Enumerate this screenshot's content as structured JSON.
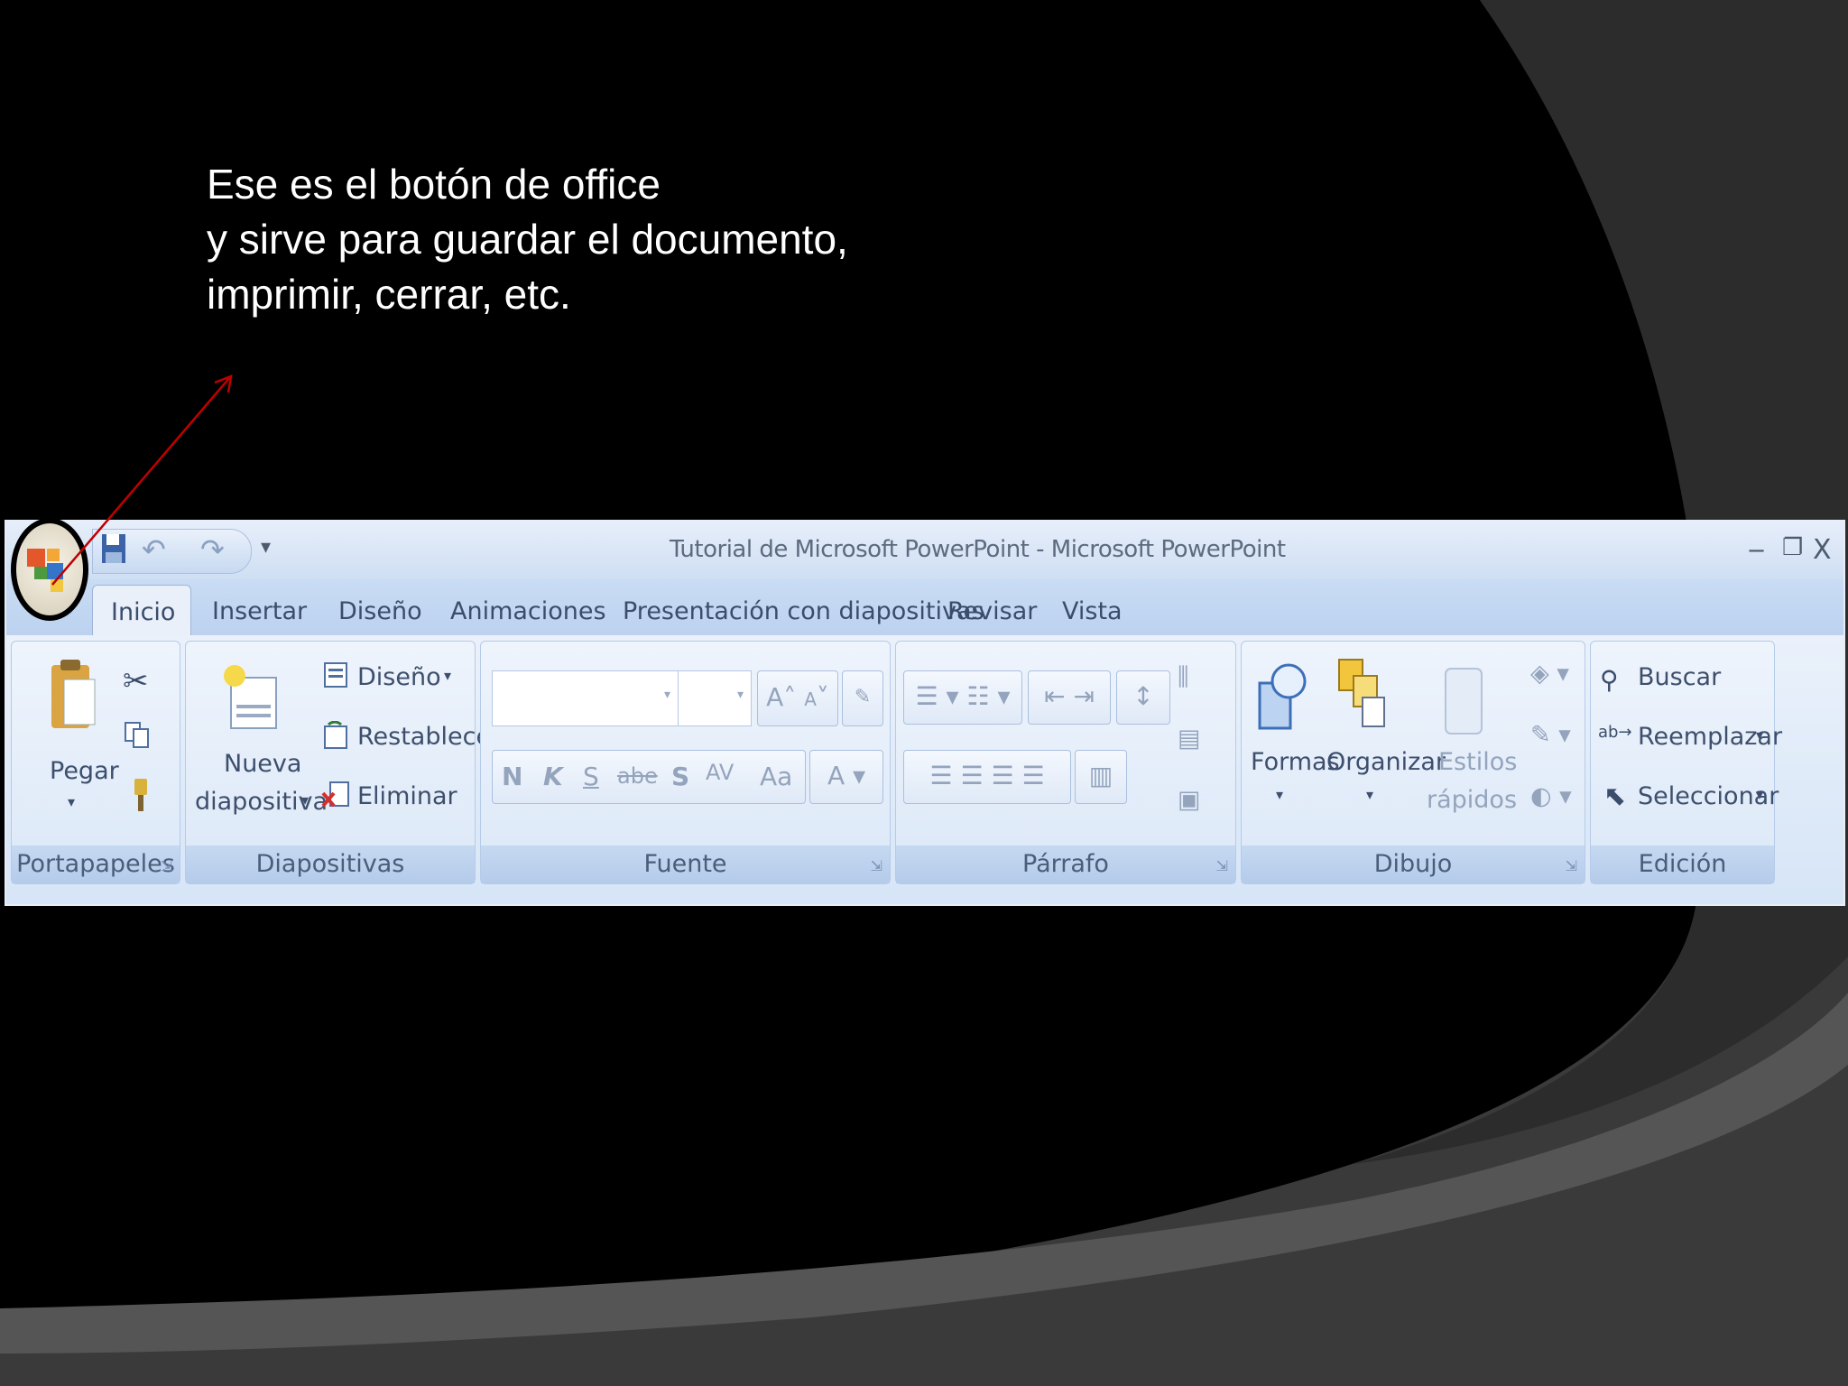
{
  "slide": {
    "caption_lines": [
      "Ese es el botón de office",
      "y sirve para  guardar el documento,",
      "imprimir, cerrar, etc."
    ]
  },
  "window": {
    "title": "Tutorial de Microsoft PowerPoint - Microsoft PowerPoint",
    "controls": {
      "minimize": "‒",
      "restore": "❐",
      "close": "X"
    }
  },
  "tabs": [
    "Inicio",
    "Insertar",
    "Diseño",
    "Animaciones",
    "Presentación con diapositivas",
    "Revisar",
    "Vista"
  ],
  "groups": {
    "clipboard": {
      "label": "Portapapeles",
      "paste": "Pegar"
    },
    "slides": {
      "label": "Diapositivas",
      "new_line1": "Nueva",
      "new_line2": "diapositiva",
      "layout": "Diseño",
      "reset": "Restablecer",
      "delete": "Eliminar"
    },
    "font": {
      "label": "Fuente",
      "bold": "N",
      "italic": "K",
      "underline": "S",
      "strike": "abe",
      "shadow": "S",
      "spacing": "AV",
      "case": "Aa",
      "color": "A",
      "grow": "A",
      "shrink": "A"
    },
    "paragraph": {
      "label": "Párrafo"
    },
    "drawing": {
      "label": "Dibujo",
      "shapes": "Formas",
      "arrange": "Organizar",
      "quick_line1": "Estilos",
      "quick_line2": "rápidos"
    },
    "editing": {
      "label": "Edición",
      "find": "Buscar",
      "replace": "Reemplazar",
      "select": "Seleccionar"
    }
  },
  "colors": {
    "ribbon_bg": "#d4e3f6",
    "annotation": "#c00000"
  }
}
